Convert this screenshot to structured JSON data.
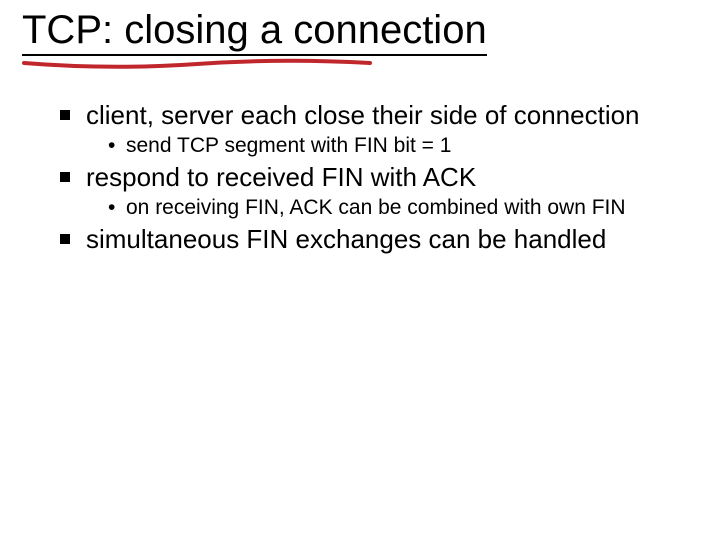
{
  "title": "TCP: closing a connection",
  "bullets": {
    "b1": "client, server each close their side of connection",
    "b1_sub1": "send TCP segment with FIN bit = 1",
    "b2": "respond to received FIN with ACK",
    "b2_sub1": "on receiving FIN, ACK can be combined with own FIN",
    "b3": "simultaneous FIN exchanges can be handled"
  }
}
